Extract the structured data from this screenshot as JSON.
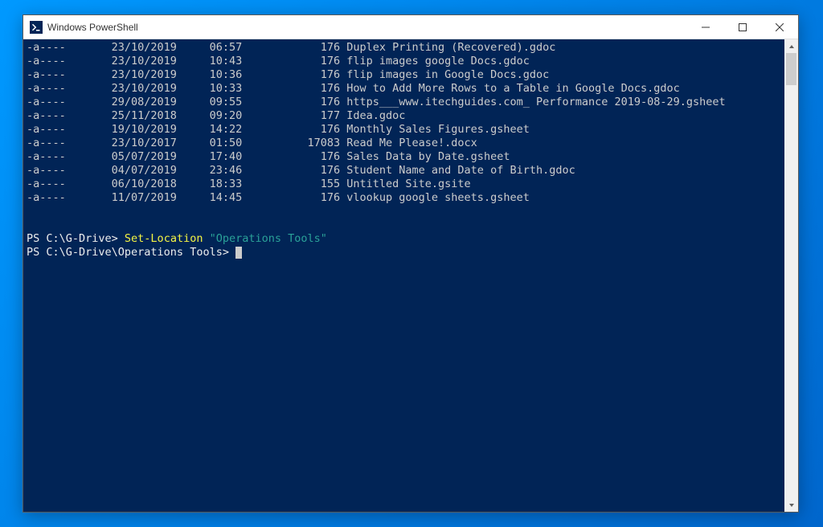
{
  "window": {
    "title": "Windows PowerShell"
  },
  "listing": [
    {
      "mode": "-a----",
      "date": "23/10/2019",
      "time": "06:57",
      "size": "176",
      "name": "Duplex Printing (Recovered).gdoc"
    },
    {
      "mode": "-a----",
      "date": "23/10/2019",
      "time": "10:43",
      "size": "176",
      "name": "flip images google Docs.gdoc"
    },
    {
      "mode": "-a----",
      "date": "23/10/2019",
      "time": "10:36",
      "size": "176",
      "name": "flip images in Google Docs.gdoc"
    },
    {
      "mode": "-a----",
      "date": "23/10/2019",
      "time": "10:33",
      "size": "176",
      "name": "How to Add More Rows to a Table in Google Docs.gdoc"
    },
    {
      "mode": "-a----",
      "date": "29/08/2019",
      "time": "09:55",
      "size": "176",
      "name": "https___www.itechguides.com_ Performance 2019-08-29.gsheet"
    },
    {
      "mode": "-a----",
      "date": "25/11/2018",
      "time": "09:20",
      "size": "177",
      "name": "Idea.gdoc"
    },
    {
      "mode": "-a----",
      "date": "19/10/2019",
      "time": "14:22",
      "size": "176",
      "name": "Monthly Sales Figures.gsheet"
    },
    {
      "mode": "-a----",
      "date": "23/10/2017",
      "time": "01:50",
      "size": "17083",
      "name": "Read Me Please!.docx"
    },
    {
      "mode": "-a----",
      "date": "05/07/2019",
      "time": "17:40",
      "size": "176",
      "name": "Sales Data by Date.gsheet"
    },
    {
      "mode": "-a----",
      "date": "04/07/2019",
      "time": "23:46",
      "size": "176",
      "name": "Student Name and Date of Birth.gdoc"
    },
    {
      "mode": "-a----",
      "date": "06/10/2018",
      "time": "18:33",
      "size": "155",
      "name": "Untitled Site.gsite"
    },
    {
      "mode": "-a----",
      "date": "11/07/2019",
      "time": "14:45",
      "size": "176",
      "name": "vlookup google sheets.gsheet"
    }
  ],
  "prompt1": {
    "prefix": "PS C:\\G-Drive> ",
    "cmd": "Set-Location",
    "arg": " \"Operations Tools\""
  },
  "prompt2": {
    "prefix": "PS C:\\G-Drive\\Operations Tools> "
  }
}
